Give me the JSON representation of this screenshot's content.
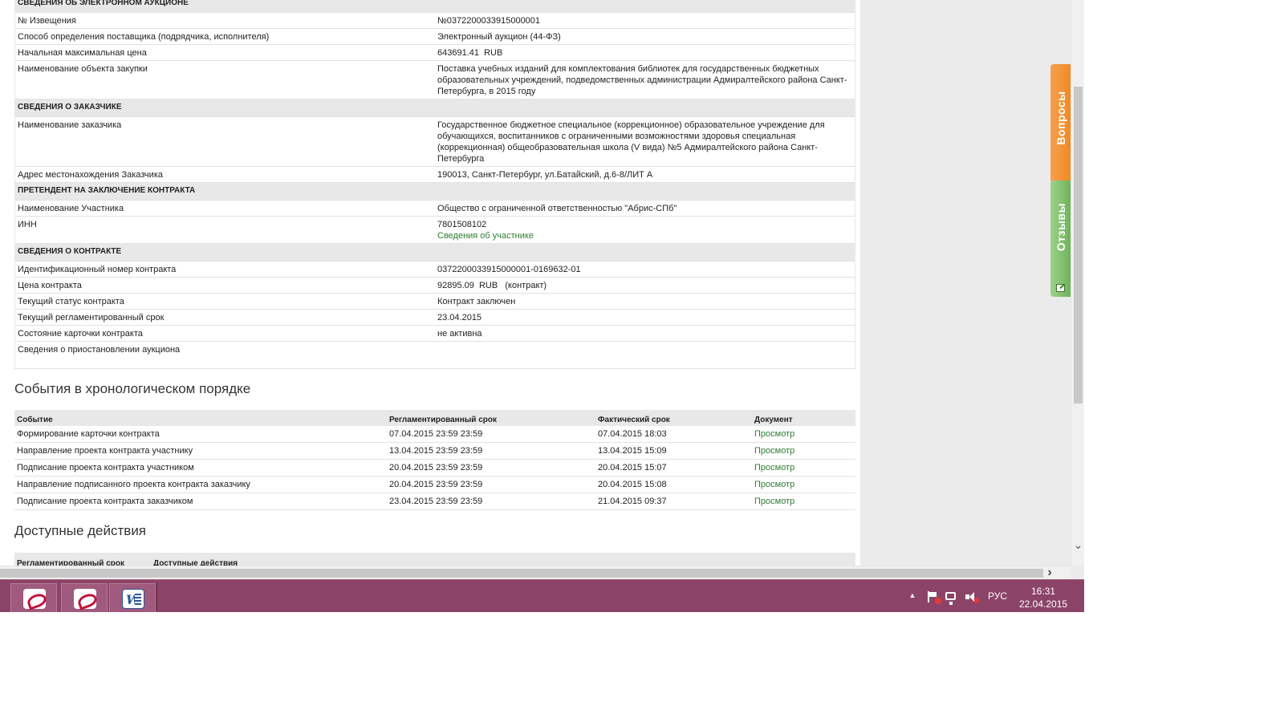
{
  "notice": {
    "section_title": "СВЕДЕНИЯ ОБ ЭЛЕКТРОННОМ АУКЦИОНЕ",
    "rows": [
      {
        "label": "№ Извещения",
        "value": "№0372200033915000001"
      },
      {
        "label": "Способ определения поставщика (подрядчика, исполнителя)",
        "value": "Электронный аукцион (44-ФЗ)"
      },
      {
        "label": "Начальная максимальная цена",
        "value": "643691.41  RUB"
      },
      {
        "label": "Наименование объекта закупки",
        "value": "Поставка учебных изданий для комплектования библиотек для государственных бюджетных образовательных учреждений, подведомственных администрации Адмиралтейского района Санкт-Петербурга, в 2015 году"
      }
    ]
  },
  "customer": {
    "section_title": "СВЕДЕНИЯ О ЗАКАЗЧИКЕ",
    "rows": [
      {
        "label": "Наименование заказчика",
        "value": "Государственное бюджетное специальное (коррекционное) образовательное учреждение для обучающихся, воспитанников с ограниченными возможностями здоровья специальная (коррекционная) общеобразовательная школа (V вида) №5 Адмиралтейского района Санкт-Петербурга"
      },
      {
        "label": "Адрес местонахождения Заказчика",
        "value": "190013, Санкт-Петербург, ул.Батайский, д.6-8/ЛИТ А"
      }
    ]
  },
  "applicant": {
    "section_title": "ПРЕТЕНДЕНТ НА ЗАКЛЮЧЕНИЕ КОНТРАКТА",
    "rows": [
      {
        "label": "Наименование Участника",
        "value": "Общество с ограниченной ответственностью \"Абрис-СПб\""
      },
      {
        "label": "ИНН",
        "value": "7801508102",
        "link": "Сведения об участнике"
      }
    ]
  },
  "contract": {
    "section_title": "СВЕДЕНИЯ О КОНТРАКТЕ",
    "rows": [
      {
        "label": "Идентификационный номер контракта",
        "value": "0372200033915000001-0169632-01"
      },
      {
        "label": "Цена контракта",
        "value": "92895.09  RUB   (контракт)"
      },
      {
        "label": "Текущий статус контракта",
        "value": "Контракт заключен"
      },
      {
        "label": "Текущий регламентированный срок",
        "value": "23.04.2015"
      },
      {
        "label": "Состояние карточки контракта",
        "value": "не активна"
      },
      {
        "label": "Сведения о приостановлении аукциона",
        "value": ""
      }
    ]
  },
  "events": {
    "title": "События в хронологическом порядке",
    "columns": [
      "Событие",
      "Регламентированный срок",
      "Фактический срок",
      "Документ"
    ],
    "rows": [
      {
        "event": "Формирование карточки контракта",
        "deadline": "07.04.2015 23:59 23:59",
        "actual": "07.04.2015 18:03",
        "doc": "Просмотр"
      },
      {
        "event": "Направление проекта контракта участнику",
        "deadline": "13.04.2015 23:59 23:59",
        "actual": "13.04.2015 15:09",
        "doc": "Просмотр"
      },
      {
        "event": "Подписание проекта контракта участником",
        "deadline": "20.04.2015 23:59 23:59",
        "actual": "20.04.2015 15:07",
        "doc": "Просмотр"
      },
      {
        "event": "Направление подписанного проекта контракта заказчику",
        "deadline": "20.04.2015 23:59 23:59",
        "actual": "20.04.2015 15:08",
        "doc": "Просмотр"
      },
      {
        "event": "Подписание проекта контракта заказчиком",
        "deadline": "23.04.2015 23:59 23:59",
        "actual": "21.04.2015 09:37",
        "doc": "Просмотр"
      }
    ]
  },
  "actions": {
    "title": "Доступные действия",
    "columns": [
      "Регламентированный срок",
      "Доступные действия"
    ]
  },
  "side_tabs": {
    "questions": "Вопросы",
    "reviews": "Отзывы"
  },
  "taskbar": {
    "apps": [
      {
        "icon": "acrobat-icon"
      },
      {
        "icon": "acrobat-icon"
      },
      {
        "icon": "word-icon"
      }
    ],
    "tray": {
      "language": "РУС",
      "time": "16:31",
      "date": "22.04.2015"
    },
    "color": "#8b4468"
  },
  "colors": {
    "link": "#2e7d32",
    "tab_questions": "#f08a24",
    "tab_reviews": "#6fb35b",
    "section_bg": "#e8e8e8"
  }
}
